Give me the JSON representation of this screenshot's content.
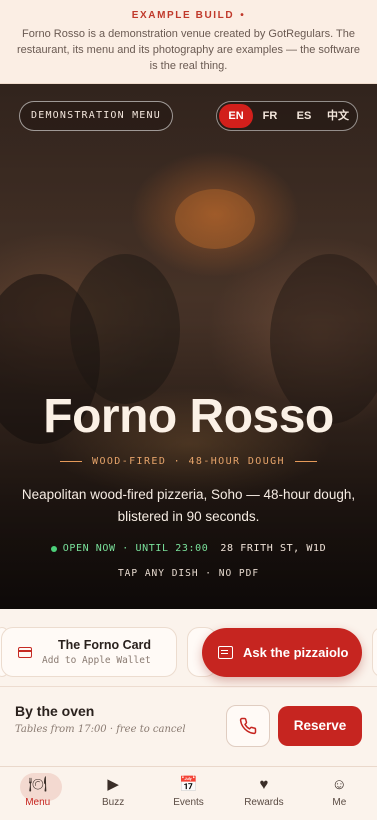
{
  "banner": {
    "title": "EXAMPLE BUILD",
    "bullet": "•",
    "text": "Forno Rosso is a demonstration venue created by GotRegulars. The restaurant, its menu and its photography are examples — the software is the real thing."
  },
  "hero": {
    "demo_label": "DEMONSTRATION MENU",
    "languages": [
      "EN",
      "FR",
      "ES",
      "中文"
    ],
    "active_language": "EN",
    "title": "Forno Rosso",
    "tagline": "WOOD-FIRED · 48-HOUR DOUGH",
    "description": "Neapolitan wood-fired pizzeria, Soho — 48-hour dough, blistered in 90 seconds.",
    "status_open": "OPEN NOW · UNTIL 23:00",
    "address": "28 FRITH ST, W1D",
    "hint": "TAP ANY DISH · NO PDF"
  },
  "cards": {
    "forno_card_title": "The Forno Card",
    "forno_card_sub": "Add to Apple Wallet",
    "ask_label": "Ask the pizzaiolo"
  },
  "reserve": {
    "title": "By the oven",
    "subtitle": "Tables from 17:00 · free to cancel",
    "button": "Reserve"
  },
  "tabs": [
    {
      "label": "Menu",
      "icon": "menu-icon",
      "glyph": "🍽"
    },
    {
      "label": "Buzz",
      "icon": "play-icon",
      "glyph": "▶"
    },
    {
      "label": "Events",
      "icon": "calendar-icon",
      "glyph": "📅"
    },
    {
      "label": "Rewards",
      "icon": "heart-icon",
      "glyph": "♥"
    },
    {
      "label": "Me",
      "icon": "smiley-icon",
      "glyph": "☺"
    }
  ],
  "colors": {
    "accent": "#c62520",
    "open_green": "#4cd07a",
    "tagline": "#e5a36a"
  }
}
